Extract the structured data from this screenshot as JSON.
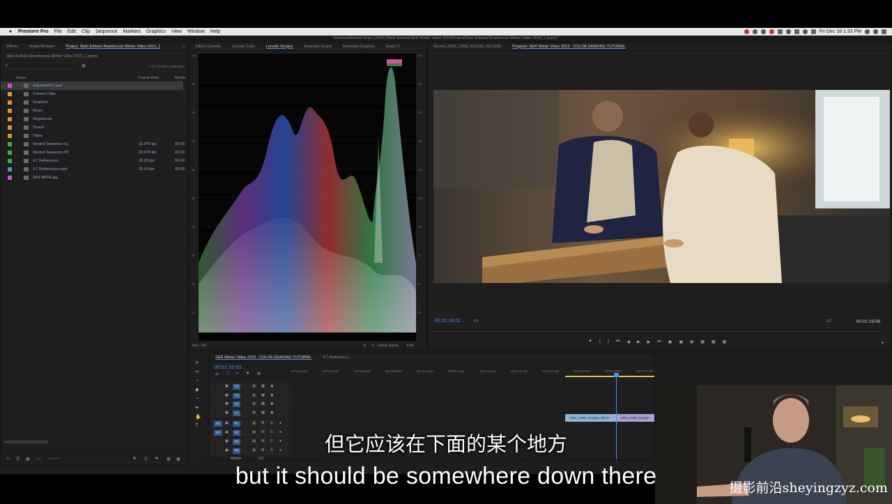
{
  "menubar": {
    "app": "Premiere Pro",
    "items": [
      "File",
      "Edit",
      "Clip",
      "Sequence",
      "Markers",
      "Graphics",
      "View",
      "Window",
      "Help"
    ],
    "clock": "Fri Dec 18  1:33 PM"
  },
  "titlebar": "/Volumes/Archive Drive (2018-)/Stein Eriksen/SER Winter Video 2019/Project/Stein Eriksen Residences Winter Video 2019_1.prproj *",
  "project": {
    "tabs": [
      "Effects",
      "Media Browser",
      "Project: Stein Eriksen Residences Winter Video 2019_1"
    ],
    "crumb": "Stein Eriksen Residences Winter Video 2019_1.prproj",
    "count": "1 of 13 items selected",
    "col_name": "Name",
    "col_frame_rate": "Frame Rate",
    "col_media": "Media",
    "rows": [
      {
        "name": "Adjustment Layer",
        "rate": "",
        "media": "",
        "color": "#c65bc6",
        "sel": true,
        "folder": false
      },
      {
        "name": "Colored Clips",
        "rate": "",
        "media": "",
        "color": "#e0962a",
        "sel": false,
        "folder": true
      },
      {
        "name": "Graphics",
        "rate": "",
        "media": "",
        "color": "#e0962a",
        "sel": false,
        "folder": true
      },
      {
        "name": "Music",
        "rate": "",
        "media": "",
        "color": "#e0962a",
        "sel": false,
        "folder": true
      },
      {
        "name": "Sequences",
        "rate": "",
        "media": "",
        "color": "#e0962a",
        "sel": false,
        "folder": true
      },
      {
        "name": "Sound",
        "rate": "",
        "media": "",
        "color": "#e0962a",
        "sel": false,
        "folder": true
      },
      {
        "name": "Video",
        "rate": "",
        "media": "",
        "color": "#e0962a",
        "sel": false,
        "folder": true
      },
      {
        "name": "Nested Sequence 01",
        "rate": "23.976 fps",
        "media": "00:00",
        "color": "#3fb04a",
        "sel": false,
        "folder": false
      },
      {
        "name": "Nested Sequence 03",
        "rate": "23.976 fps",
        "media": "00:00",
        "color": "#3fb04a",
        "sel": false,
        "folder": false
      },
      {
        "name": "4.7 References",
        "rate": "25.00 fps",
        "media": "00:00",
        "color": "#3fb04a",
        "sel": false,
        "folder": false
      },
      {
        "name": "4.7 References.mp4",
        "rate": "25.00 fps",
        "media": "00:00",
        "color": "#5a8fd0",
        "sel": false,
        "folder": false
      },
      {
        "name": "SAS MFRF.jpg",
        "rate": "",
        "media": "",
        "color": "#c65bc6",
        "sel": false,
        "folder": false
      }
    ]
  },
  "scopes": {
    "tabs": [
      "Effect Controls",
      "Lumetri Color",
      "Lumetri Scopes",
      "Essential Sound",
      "Essential Graphics",
      "Audio Tr"
    ],
    "left_labels": [
      "100",
      "90",
      "80",
      "70",
      "60",
      "50",
      "40",
      "30",
      "20",
      "10"
    ],
    "right_labels": [
      "255",
      "230",
      "204",
      "178",
      "153",
      "128",
      "102",
      "76",
      "51",
      "26"
    ],
    "footer_left": "Rec. 709",
    "clamp": "Clamp Signal",
    "bit": "8 Bit"
  },
  "monitor": {
    "source_tab": "Source: A001_C058_0113QU_001.R3D",
    "program_tab": "Program: SER Winter Video 2019 - COLOR GRADING TUTORIAL",
    "timecode_left": "00:01:16:02",
    "fit": "Fit",
    "ratio": "1/2",
    "timecode_right": "00:01:19:08"
  },
  "timeline": {
    "tabs": [
      "SER Winter Video 2019 - COLOR GRADING TUTORIAL",
      "4.7 References"
    ],
    "timecode": "00:01:16:02",
    "ticks": [
      "00:01:06:00",
      "00:01:07:00",
      "00:01:08:00",
      "00:01:09:00",
      "00:01:10:00",
      "00:01:11:00",
      "00:01:12:00",
      "00:01:13:00",
      "00:01:14:00",
      "00:01:15:00",
      "00:01:16:00",
      "00:01:17:00"
    ],
    "video_tracks": [
      "V4",
      "V3",
      "V2",
      "V1"
    ],
    "audio_tracks": [
      "A1",
      "A2",
      "A3",
      "A4"
    ],
    "master": "Master",
    "master_val": "0.0",
    "clips": [
      "A001_C058_0113QU_001.R",
      "A001_C058_0113QI"
    ]
  },
  "subtitles": {
    "cn": "但它应该在下面的某个地方",
    "en": "but it should be somewhere down there"
  },
  "watermark": "摄影前沿sheyingzyz.com"
}
